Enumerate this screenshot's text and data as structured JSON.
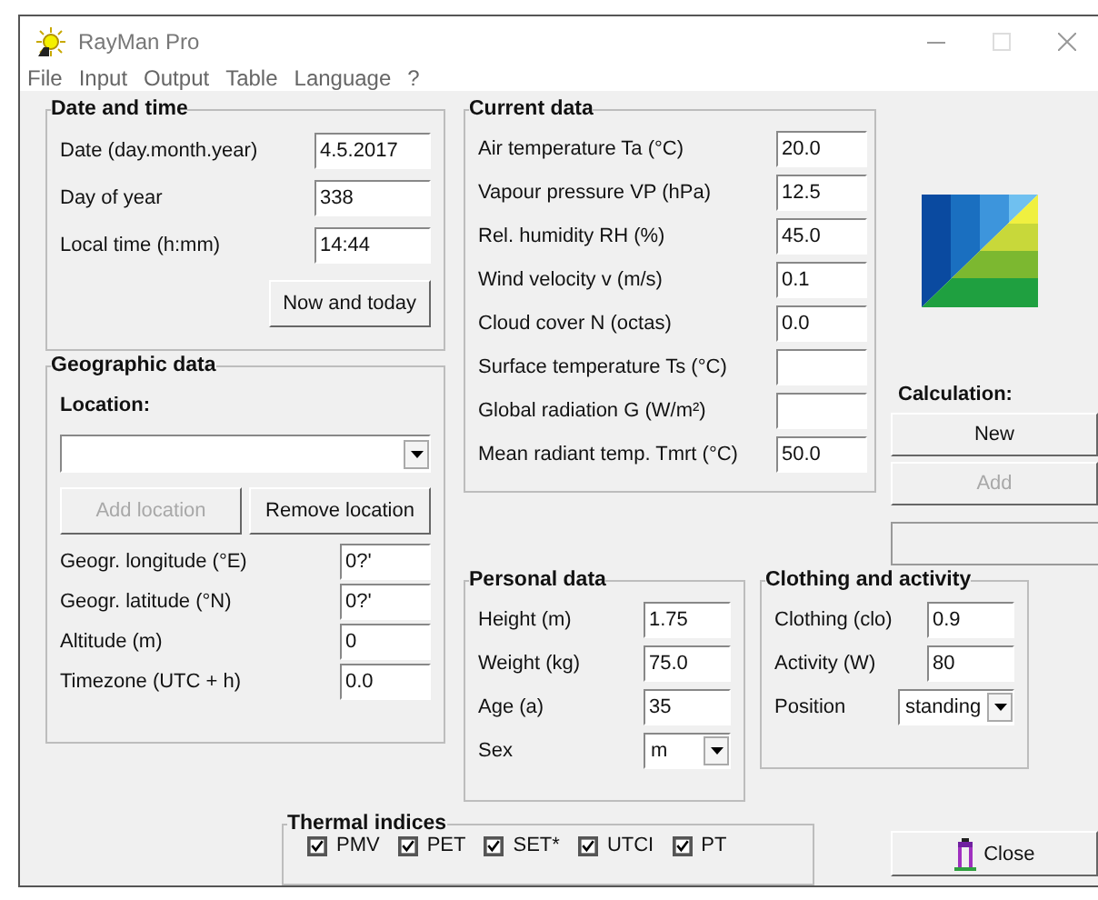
{
  "window": {
    "title": "RayMan Pro"
  },
  "menu": [
    "File",
    "Input",
    "Output",
    "Table",
    "Language",
    "?"
  ],
  "date_and_time": {
    "title": "Date and time",
    "fields": [
      {
        "label": "Date (day.month.year)",
        "value": "4.5.2017"
      },
      {
        "label": "Day of year",
        "value": "338"
      },
      {
        "label": "Local time (h:mm)",
        "value": "14:44"
      }
    ],
    "button": "Now and today"
  },
  "geographic_data": {
    "title": "Geographic data",
    "location_label": "Location:",
    "buttons": [
      {
        "label": "Add location",
        "disabled": true
      },
      {
        "label": "Remove location",
        "disabled": false
      }
    ],
    "fields": [
      {
        "label": "Geogr. longitude (°E)",
        "value": "0?'"
      },
      {
        "label": "Geogr. latitude (°N)",
        "value": "0?'"
      },
      {
        "label": "Altitude (m)",
        "value": "0"
      },
      {
        "label": "Timezone (UTC + h)",
        "value": "0.0"
      }
    ]
  },
  "current_data": {
    "title": "Current data",
    "fields": [
      {
        "label": "Air temperature Ta (°C)",
        "value": "20.0"
      },
      {
        "label": "Vapour pressure VP (hPa)",
        "value": "12.5"
      },
      {
        "label": "Rel. humidity RH (%)",
        "value": "45.0"
      },
      {
        "label": "Wind velocity v (m/s)",
        "value": "0.1"
      },
      {
        "label": "Cloud cover N (octas)",
        "value": "0.0"
      },
      {
        "label": "Surface temperature Ts (°C)"
      },
      {
        "label": "Global radiation G (W/m²)"
      },
      {
        "label": "Mean radiant temp. Tmrt (°C)",
        "value": "50.0"
      }
    ]
  },
  "calculation": {
    "label": "Calculation:",
    "buttons": [
      {
        "label": "New",
        "disabled": false
      },
      {
        "label": "Add",
        "disabled": true
      }
    ]
  },
  "personal_data": {
    "title": "Personal data",
    "fields": [
      {
        "label": "Height (m)",
        "value": "1.75",
        "kind": "text"
      },
      {
        "label": "Weight (kg)",
        "value": "75.0",
        "kind": "text"
      },
      {
        "label": "Age (a)",
        "value": "35",
        "kind": "text"
      },
      {
        "label": "Sex",
        "value": "m",
        "kind": "dropdown"
      }
    ]
  },
  "clothing_and_activity": {
    "title": "Clothing and activity",
    "fields": [
      {
        "label": "Clothing (clo)",
        "value": "0.9",
        "kind": "text"
      },
      {
        "label": "Activity (W)",
        "value": "80",
        "kind": "text"
      },
      {
        "label": "Position",
        "value": "standing",
        "kind": "dropdown"
      }
    ]
  },
  "thermal_indices": {
    "title": "Thermal indices",
    "items": [
      {
        "label": "PMV",
        "checked": true
      },
      {
        "label": "PET",
        "checked": true
      },
      {
        "label": "SET*",
        "checked": true
      },
      {
        "label": "UTCI",
        "checked": true
      },
      {
        "label": "PT",
        "checked": true
      }
    ]
  },
  "close_button": "Close"
}
